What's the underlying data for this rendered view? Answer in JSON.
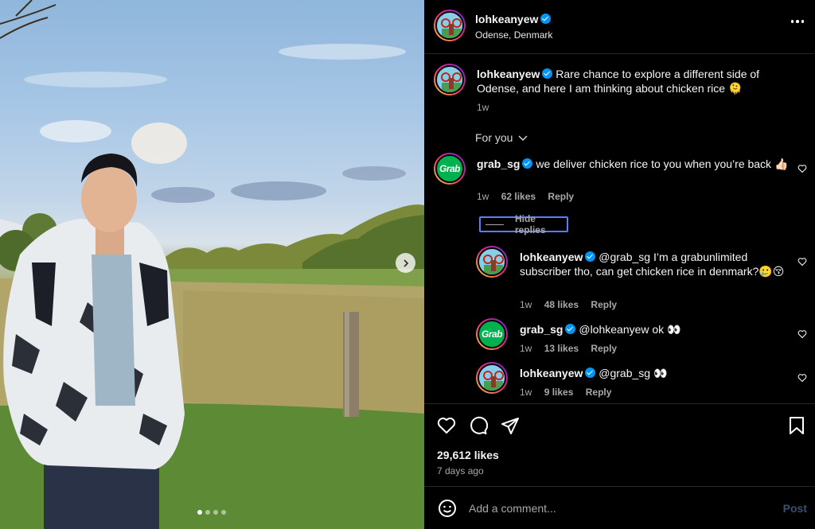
{
  "post": {
    "username": "lohkeanyew",
    "location": "Odense, Denmark",
    "caption_text": "Rare chance to explore a different side of Odense, and here I am thinking about chicken rice 🫠",
    "caption_time": "1w",
    "likes": "29,612 likes",
    "posted_ago": "7 days ago"
  },
  "sort": {
    "label": "For you"
  },
  "comments": [
    {
      "username": "grab_sg",
      "text": "we deliver chicken rice to you when you’re back 👍🏻",
      "time": "1w",
      "likes": "62 likes",
      "reply": "Reply"
    }
  ],
  "hide_replies_label": "Hide replies",
  "replies": [
    {
      "username": "lohkeanyew",
      "text": "@grab_sg I’m a grabunlimited subscriber tho, can get chicken rice in denmark?🥲😚",
      "time": "1w",
      "likes": "48 likes",
      "reply": "Reply"
    },
    {
      "username": "grab_sg",
      "text": "@lohkeanyew ok 👀",
      "time": "1w",
      "likes": "13 likes",
      "reply": "Reply"
    },
    {
      "username": "lohkeanyew",
      "text": "@grab_sg 👀",
      "time": "1w",
      "likes": "9 likes",
      "reply": "Reply"
    }
  ],
  "add_comment": {
    "placeholder": "Add a comment...",
    "post_label": "Post"
  },
  "brand": {
    "grab_logo_text": "Grab",
    "grab_color": "#00b14f",
    "verified_color": "#0095f6"
  },
  "icons": [
    "more-icon",
    "heart-icon",
    "comment-icon",
    "share-icon",
    "bookmark-icon",
    "emoji-icon",
    "chevron-right-icon",
    "chevron-down-icon"
  ]
}
